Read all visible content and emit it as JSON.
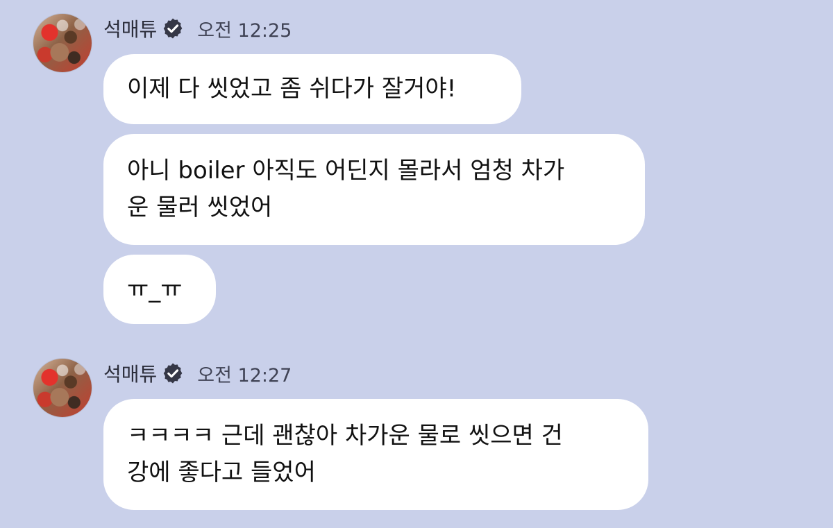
{
  "chat": {
    "groups": [
      {
        "sender": "석매튜",
        "time": "오전 12:25",
        "messages": [
          "이제 다 씻었고 좀 쉬다가 잘거야!",
          "아니 boiler 아직도 어딘지 몰라서 엄청 차가\n운 물러 씻었어",
          "ㅠ_ㅠ"
        ]
      },
      {
        "sender": "석매튜",
        "time": "오전 12:27",
        "messages": [
          "ㅋㅋㅋㅋ 근데 괜찮아 차가운 물로 씻으면 건\n강에 좋다고 들었어"
        ]
      }
    ]
  },
  "icons": {
    "verified": "verified-badge-icon"
  },
  "colors": {
    "background": "#c9d0ea",
    "bubble": "#ffffff",
    "text": "#111111"
  }
}
